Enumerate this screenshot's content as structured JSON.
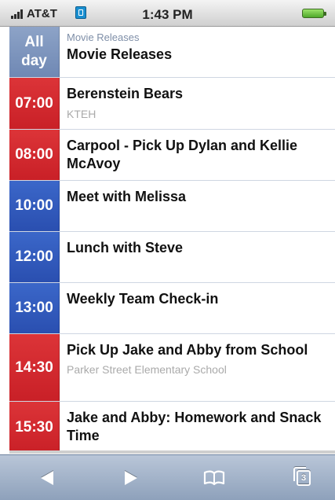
{
  "status_bar": {
    "carrier": "AT&T",
    "time": "1:43 PM"
  },
  "all_day": {
    "label_line1": "All",
    "label_line2": "day",
    "calendar": "Movie Releases",
    "title": "Movie Releases"
  },
  "events": [
    {
      "time": "07:00",
      "color": "#d12a2f",
      "title": "Berenstein Bears",
      "subtitle": "KTEH"
    },
    {
      "time": "08:00",
      "color": "#d12a2f",
      "title": "Carpool - Pick Up Dylan and Kellie McAvoy",
      "subtitle": ""
    },
    {
      "time": "10:00",
      "color": "#3059bd",
      "title": "Meet with Melissa",
      "subtitle": ""
    },
    {
      "time": "12:00",
      "color": "#3059bd",
      "title": "Lunch with Steve",
      "subtitle": ""
    },
    {
      "time": "13:00",
      "color": "#3059bd",
      "title": "Weekly Team Check-in",
      "subtitle": ""
    },
    {
      "time": "14:30",
      "color": "#d12a2f",
      "title": "Pick Up Jake and Abby from School",
      "subtitle": "Parker Street Elementary School"
    },
    {
      "time": "15:30",
      "color": "#d12a2f",
      "title": "Jake and Abby: Homework and Snack Time",
      "subtitle": ""
    }
  ],
  "toolbar": {
    "back_icon": "back-arrow-icon",
    "forward_icon": "forward-arrow-icon",
    "bookmarks_icon": "bookmarks-book-icon",
    "pages_icon": "pages-icon",
    "pages_count": "3"
  }
}
